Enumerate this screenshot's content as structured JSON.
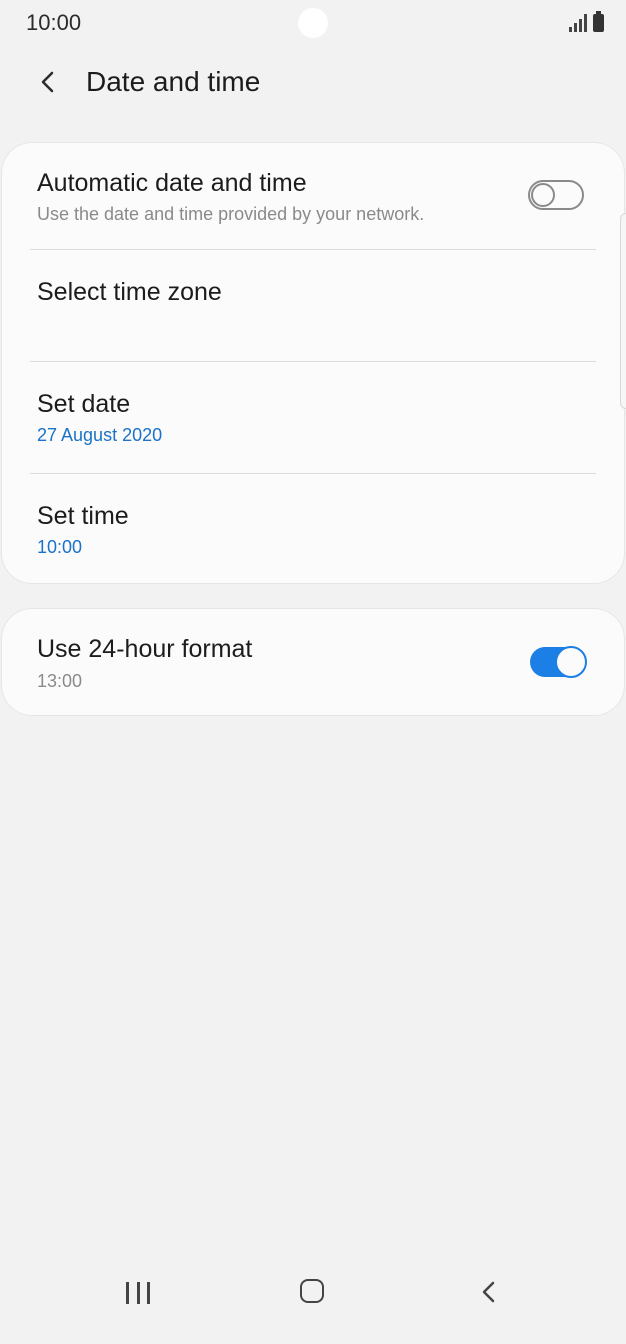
{
  "status_bar": {
    "time": "10:00",
    "icons": [
      "camera-hole",
      "signal-icon",
      "battery-icon"
    ]
  },
  "header": {
    "back_icon": "chevron-left-icon",
    "title": "Date and time"
  },
  "settings_group_1": {
    "automatic": {
      "title": "Automatic date and time",
      "subtitle": "Use the date and time provided by your network.",
      "toggle_on": false
    },
    "time_zone": {
      "title": "Select time zone"
    },
    "set_date": {
      "title": "Set date",
      "value": "27 August 2020"
    },
    "set_time": {
      "title": "Set time",
      "value": "10:00"
    }
  },
  "settings_group_2": {
    "format_24h": {
      "title": "Use 24-hour format",
      "value": "13:00",
      "toggle_on": true
    }
  },
  "nav_bar": {
    "icons": [
      "recents-icon",
      "home-icon",
      "back-icon"
    ]
  },
  "colors": {
    "accent": "#1b7fe6",
    "value_blue": "#1a73c8",
    "background": "#f2f2f2",
    "card": "#fbfbfb"
  }
}
